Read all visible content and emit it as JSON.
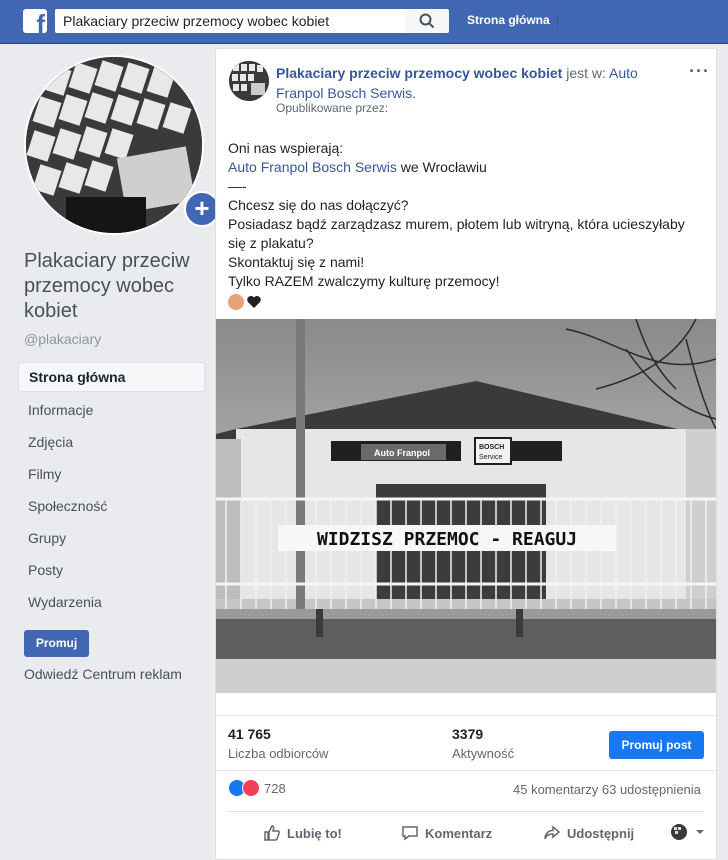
{
  "topbar": {
    "search_value": "Plakaciary przeciw przemocy wobec kobiet",
    "home_label": "Strona główna"
  },
  "page": {
    "name": "Plakaciary przeciw przemocy wobec kobiet",
    "handle": "@plakaciary"
  },
  "leftnav": {
    "items": [
      {
        "label": "Strona główna"
      },
      {
        "label": "Informacje"
      },
      {
        "label": "Zdjęcia"
      },
      {
        "label": "Filmy"
      },
      {
        "label": "Społeczność"
      },
      {
        "label": "Grupy"
      },
      {
        "label": "Posty"
      },
      {
        "label": "Wydarzenia"
      }
    ],
    "promote_label": "Promuj",
    "ads_link": "Odwiedź Centrum reklam"
  },
  "post": {
    "author": "Plakaciary przeciw przemocy wobec kobiet",
    "at_text": "jest w:",
    "location": "Auto Franpol Bosch Serwis.",
    "published_by": "Opublikowane przez:",
    "line1": "Oni nas wspierają:",
    "line2_link": "Auto Franpol Bosch Serwis",
    "line2_rest": " we Wrocławiu",
    "line3": "—-",
    "line4": "Chcesz się do nas dołączyć?",
    "line5": "Posiadasz bądź zarządzasz murem, płotem lub witryną, która ucieszyłaby się z plakatu?",
    "line6": "Skontaktuj się z nami!",
    "line7": "Tylko RAZEM zwalczymy kulturę przemocy!",
    "photo": {
      "sign_shop": "Auto Franpol",
      "sign_bosch_1": "BOSCH",
      "sign_bosch_2": "Service",
      "banner": "WIDZISZ PRZEMOC - REAGUJ"
    }
  },
  "stats": {
    "reach_value": "41 765",
    "reach_label": "Liczba odbiorców",
    "activity_value": "3379",
    "activity_label": "Aktywność",
    "promote_post_label": "Promuj post"
  },
  "engagement": {
    "reactions_count": "728",
    "comments_shares": "45 komentarzy  63 udostępnienia"
  },
  "actions": {
    "like": "Lubię to!",
    "comment": "Komentarz",
    "share": "Udostępnij"
  }
}
